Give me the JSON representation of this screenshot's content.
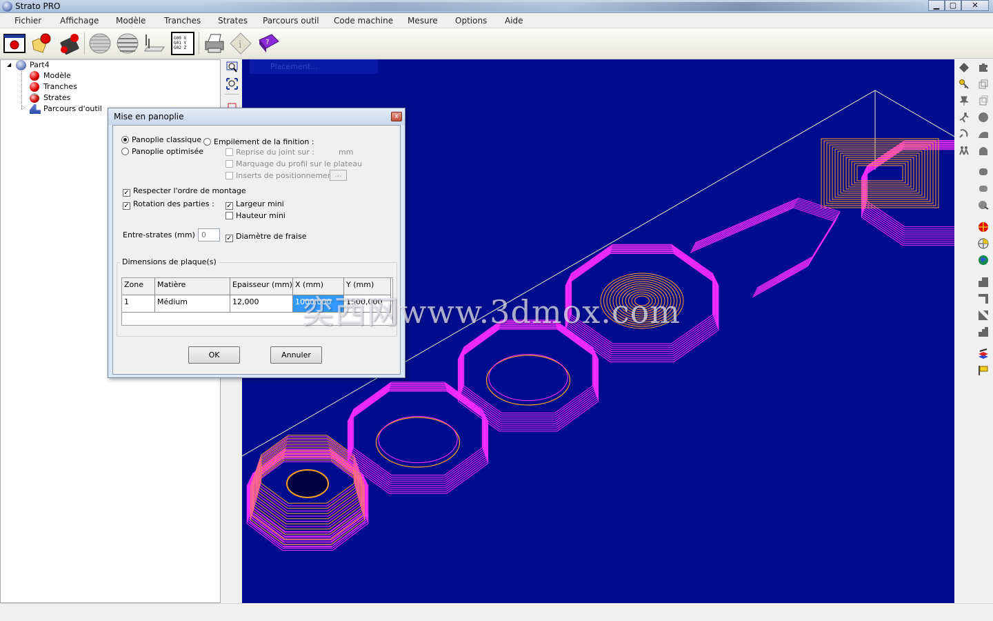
{
  "window": {
    "title": "Strato PRO",
    "btn_min": "▁",
    "btn_max": "▢",
    "btn_close": "✕"
  },
  "menu": [
    "Fichier",
    "Affichage",
    "Modèle",
    "Tranches",
    "Strates",
    "Parcours outil",
    "Code machine",
    "Mesure",
    "Options",
    "Aide"
  ],
  "toolbar": {
    "gcode_icon_text": "G00 X\nG01 Y\nG02 Z"
  },
  "tree": {
    "root": "Part4",
    "items": [
      "Modèle",
      "Tranches",
      "Strates",
      "Parcours d'outil"
    ],
    "expander": "◢",
    "collapsed_marker": "▷"
  },
  "viewport": {
    "placement_label": "Placement..."
  },
  "dialog": {
    "title": "Mise en panoplie",
    "close": "x",
    "radio_classic": "Panoplie classique",
    "radio_optimized": "Panoplie optimisée",
    "empilement": "Empilement de la finition :",
    "reprise": "Reprise du joint sur :",
    "reprise_unit": "mm",
    "marquage": "Marquage du profil sur le plateau",
    "inserts": "Inserts de positionnement",
    "inserts_btn": "...",
    "respecter": "Respecter l'ordre de montage",
    "rotation": "Rotation des parties :",
    "largeur": "Largeur mini",
    "hauteur": "Hauteur mini",
    "entre_label": "Entre-strates (mm) :",
    "entre_value": "0",
    "diametre": "Diamètre de fraise",
    "dimensions_label": "Dimensions de plaque(s)",
    "check_mark": "✓",
    "table": {
      "headers": [
        "Zone",
        "Matière",
        "Epaisseur (mm)",
        "X (mm)",
        "Y (mm)"
      ],
      "rows": [
        [
          "1",
          "Médium",
          "12,000",
          "1000,000",
          "1500,000"
        ]
      ]
    },
    "ok": "OK",
    "cancel": "Annuler"
  },
  "watermark": "奕西网www.3dmox.com",
  "colors": {
    "viewport_bg": "#000c8e",
    "toolpath_magenta": "#ff2cff",
    "toolpath_orange": "#ffa020",
    "selection_blue": "#3399ff"
  }
}
